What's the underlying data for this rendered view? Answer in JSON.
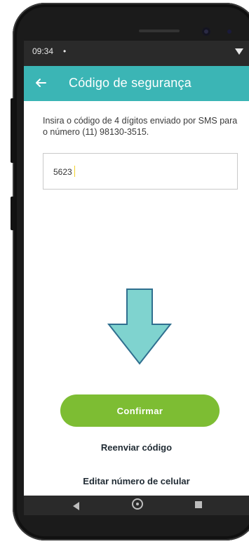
{
  "status_bar": {
    "time": "09:34",
    "dot": "•",
    "wifi_icon": "wifi-icon"
  },
  "app_bar": {
    "title": "Código de segurança",
    "back_icon": "arrow-left-icon"
  },
  "content": {
    "instructions": "Insira o código de 4 dígitos enviado por SMS para o número (11) 98130-3515.",
    "code_value": "5623",
    "arrow_icon": "arrow-down-icon",
    "confirm_label": "Confirmar",
    "resend_label": "Reenviar código",
    "edit_number_label": "Editar número de celular"
  },
  "colors": {
    "app_bar": "#3bb5b5",
    "confirm_button": "#7dbd33",
    "arrow_fill": "#7fd3cf",
    "arrow_stroke": "#2f6f8f"
  }
}
